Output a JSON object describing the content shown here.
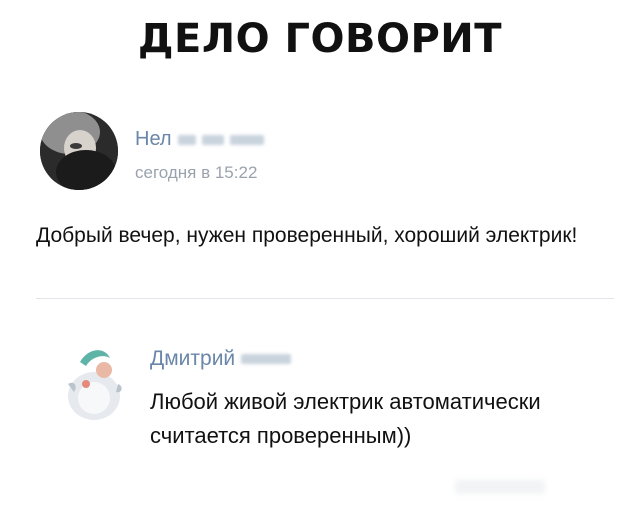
{
  "header": {
    "title": "ДЕЛО ГОВОРИТ"
  },
  "post": {
    "author_visible": "Нел",
    "time": "сегодня в 15:22",
    "text": "Добрый вечер, нужен проверенный, хороший электрик!"
  },
  "reply": {
    "author_visible": "Дмитрий",
    "text": "Любой живой электрик автоматически считается проверенным))"
  },
  "colors": {
    "author_link": "#6a86a8",
    "timestamp": "#9aa3ad",
    "divider": "#e1e4e8",
    "text": "#111111"
  }
}
